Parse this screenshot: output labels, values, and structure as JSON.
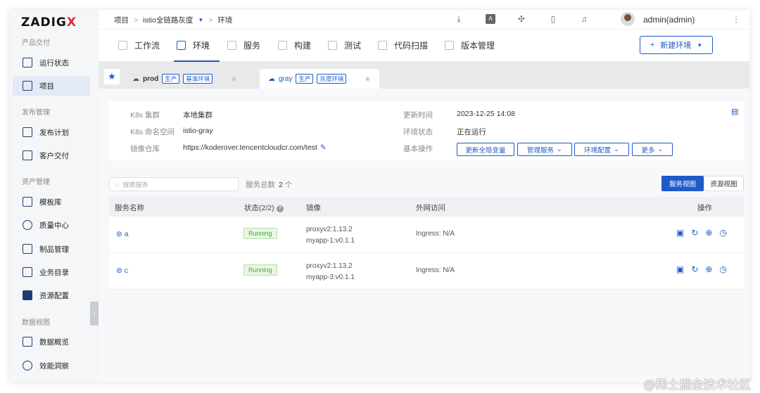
{
  "logo": {
    "text": "ZADIG",
    "accent": "X"
  },
  "sidebar": {
    "sections": [
      {
        "title": "产品交付"
      },
      {
        "title": "发布管理"
      },
      {
        "title": "资产管理"
      },
      {
        "title": "数据视图"
      }
    ],
    "items": [
      {
        "label": "运行状态",
        "icon": "pulse-icon"
      },
      {
        "label": "项目",
        "icon": "project-icon",
        "active": true
      },
      {
        "label": "发布计划",
        "icon": "plan-icon"
      },
      {
        "label": "客户交付",
        "icon": "delivery-icon"
      },
      {
        "label": "模板库",
        "icon": "template-icon"
      },
      {
        "label": "质量中心",
        "icon": "flask-icon"
      },
      {
        "label": "制品管理",
        "icon": "artifact-icon"
      },
      {
        "label": "业务目录",
        "icon": "catalog-icon"
      },
      {
        "label": "资源配置",
        "icon": "settings-icon"
      },
      {
        "label": "数据概览",
        "icon": "chart-icon"
      },
      {
        "label": "效能洞察",
        "icon": "pie-icon"
      }
    ]
  },
  "breadcrumb": {
    "root": "项目",
    "project": "istio全链路灰度",
    "sep": ">",
    "current": "环境"
  },
  "header": {
    "user": "admin(admin)"
  },
  "tabs": [
    {
      "label": "工作流"
    },
    {
      "label": "环境",
      "active": true
    },
    {
      "label": "服务"
    },
    {
      "label": "构建"
    },
    {
      "label": "测试"
    },
    {
      "label": "代码扫描"
    },
    {
      "label": "版本管理"
    }
  ],
  "new_env_button": "新建环境",
  "env_tabs": [
    {
      "name": "prod",
      "tags": [
        "生产",
        "基准环境"
      ]
    },
    {
      "name": "gray",
      "tags": [
        "生产",
        "灰度环境"
      ],
      "active": true
    }
  ],
  "info": {
    "cluster_label": "K8s 集群",
    "cluster_value": "本地集群",
    "namespace_label": "K8s 命名空间",
    "namespace_value": "istio-gray",
    "registry_label": "镜像仓库",
    "registry_value": "https://koderover.tencentcloudcr.com/test",
    "updated_label": "更新时间",
    "updated_value": "2023-12-25 14:08",
    "state_label": "环境状态",
    "state_value": "正在运行",
    "ops_label": "基本操作",
    "ops": [
      "更新全局变量",
      "管理服务",
      "环境配置",
      "更多"
    ]
  },
  "search": {
    "placeholder": "搜索服务"
  },
  "service_count": {
    "label": "服务总数",
    "value": "2",
    "unit": "个"
  },
  "views": {
    "service": "服务视图",
    "resource": "资源视图"
  },
  "table": {
    "headers": {
      "name": "服务名称",
      "status": "状态(2/2)",
      "image": "镜像",
      "access": "外网访问",
      "ops": "操作"
    },
    "rows": [
      {
        "name": "a",
        "status": "Running",
        "image1": "proxyv2:1.13.2",
        "image2": "myapp-1:v0.1.1",
        "access": "Ingress: N/A"
      },
      {
        "name": "c",
        "status": "Running",
        "image1": "proxyv2:1.13.2",
        "image2": "myapp-3:v0.1.1",
        "access": "Ingress: N/A"
      }
    ]
  },
  "watermark": "@稀土掘金技术社区",
  "colors": {
    "accent": "#1f5ac9",
    "brand_x": "#e0263a",
    "running": "#52a33a"
  }
}
